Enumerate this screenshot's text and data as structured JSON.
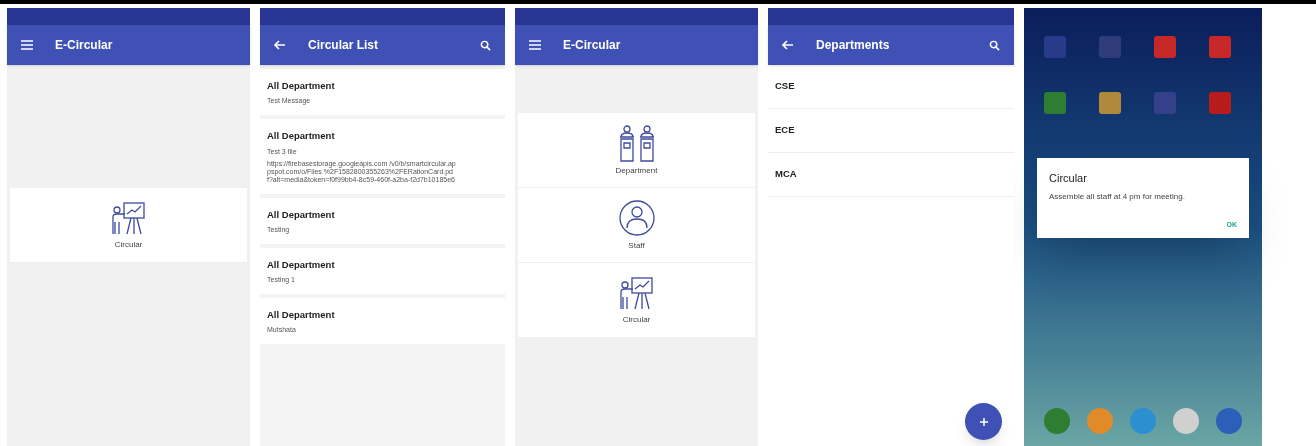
{
  "screens": [
    {
      "kind": "home",
      "title": "E-Circular",
      "nav": {
        "kind": "menu"
      },
      "tiles": [
        {
          "label": "Circular",
          "kind": "presentation"
        }
      ]
    },
    {
      "kind": "list",
      "title": "Circular List",
      "nav": {
        "kind": "back"
      },
      "items": [
        {
          "heading": "All Department",
          "lines": [
            "Test Message"
          ]
        },
        {
          "heading": "All Department",
          "lines": [
            "Test 3 file",
            "https://firebasestorage.googleapis.com /v0/b/smartcircular.appspot.com/o/Files %2F1582800355263%2FERationCard.pdf?alt=media&token=f0f99bb4-8c59-460f-a2ba-f2d7b10185e6"
          ]
        },
        {
          "heading": "All Department",
          "lines": [
            "Testing"
          ]
        },
        {
          "heading": "All Department",
          "lines": [
            "Testing 1"
          ]
        },
        {
          "heading": "All Department",
          "lines": [
            "Mutshata"
          ]
        }
      ]
    },
    {
      "kind": "home",
      "title": "E-Circular",
      "nav": {
        "kind": "menu"
      },
      "tiles": [
        {
          "label": "Department",
          "kind": "podiums"
        },
        {
          "label": "Staff",
          "kind": "person"
        },
        {
          "label": "Circular",
          "kind": "presentation"
        }
      ]
    },
    {
      "kind": "departments",
      "title": "Departments",
      "nav": {
        "kind": "back"
      },
      "items": [
        "CSE",
        "ECE",
        "MCA"
      ]
    },
    {
      "kind": "launcher",
      "dialog": {
        "title": "Circular",
        "message": "Assemble all staff at 4 pm for meeting.",
        "button": "OK"
      }
    }
  ]
}
